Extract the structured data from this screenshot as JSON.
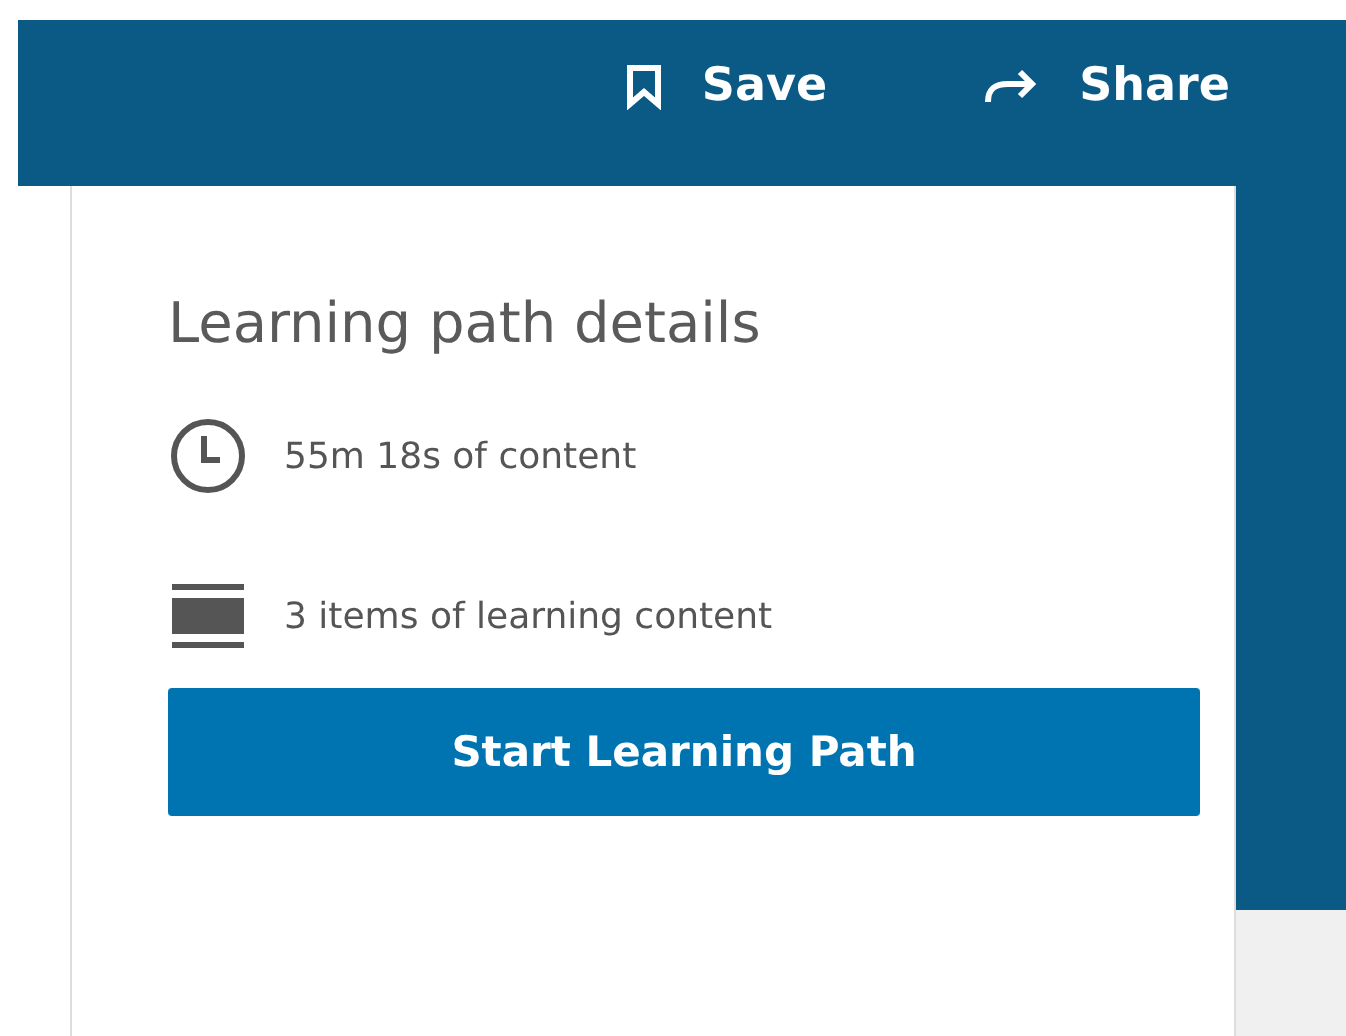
{
  "header": {
    "actions": [
      {
        "kind": "save",
        "label": "Save"
      },
      {
        "kind": "share",
        "label": "Share"
      }
    ]
  },
  "card": {
    "title": "Learning path details",
    "details": [
      {
        "kind": "duration",
        "text": "55m 18s of content"
      },
      {
        "kind": "items",
        "text": "3 items of learning content"
      }
    ],
    "button": "Start Learning Path"
  }
}
